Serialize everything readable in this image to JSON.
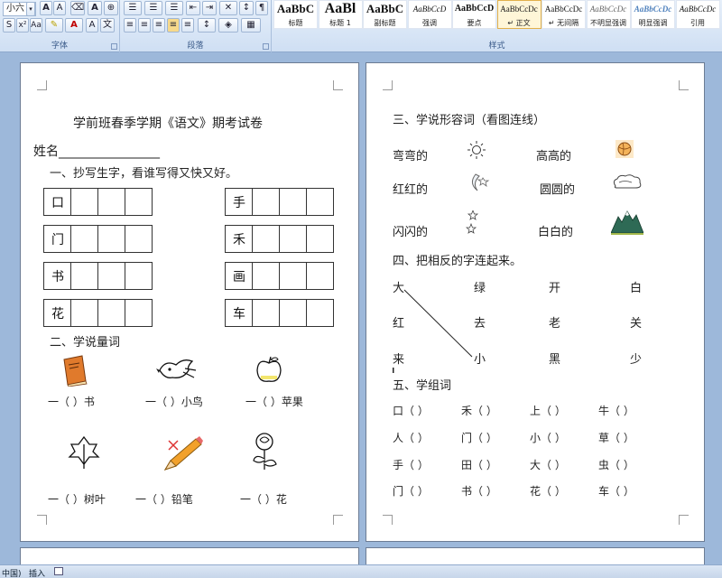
{
  "ribbon": {
    "font_name": "小六",
    "font_group_label": "字体",
    "paragraph_group_label": "段落",
    "styles_group_label": "样式",
    "styles": [
      {
        "sample": "AaBbC",
        "name": "标题"
      },
      {
        "sample": "AaBl",
        "name": "标题 1"
      },
      {
        "sample": "AaBbC",
        "name": "副标题"
      },
      {
        "sample": "AaBbCcD",
        "name": "强调"
      },
      {
        "sample": "AaBbCcD",
        "name": "要点"
      },
      {
        "sample": "AaBbCcDc",
        "name": "↵ 正文"
      },
      {
        "sample": "AaBbCcDc",
        "name": "↵ 无间隔"
      },
      {
        "sample": "AaBbCcDc",
        "name": "不明显强调"
      },
      {
        "sample": "AaBbCcDc",
        "name": "明显强调"
      },
      {
        "sample": "AaBbCcDc",
        "name": "引用"
      }
    ]
  },
  "page1": {
    "title": "学前班春季学期《语文》期考试卷",
    "name_label": "姓名________________",
    "section1": "一、抄写生字，看谁写得又快又好。",
    "left_chars": [
      "口",
      "门",
      "书",
      "花"
    ],
    "right_chars": [
      "手",
      "禾",
      "画",
      "车"
    ],
    "section2": "二、学说量词",
    "measure_row1": [
      "一（  ）书",
      "一（  ）小鸟",
      "一（  ）苹果"
    ],
    "measure_row2": [
      "一（  ）树叶",
      "一（  ）铅笔",
      "一（  ）花"
    ]
  },
  "page2": {
    "section3": "三、学说形容词（看图连线）",
    "adj_left": [
      "弯弯的",
      "红红的",
      "闪闪的"
    ],
    "adj_right": [
      "高高的",
      "圆圆的",
      "白白的"
    ],
    "section4": "四、把相反的字连起来。",
    "opp_rows": [
      [
        "大",
        "绿",
        "开",
        "白"
      ],
      [
        "红",
        "去",
        "老",
        "关"
      ],
      [
        "来",
        "小",
        "黑",
        "少"
      ]
    ],
    "section5": "五、学组词",
    "word_rows": [
      [
        "口（      ）",
        "禾（      ）",
        "上（      ）",
        "牛（      ）"
      ],
      [
        "人（      ）",
        "门（      ）",
        "小（      ）",
        "草（      ）"
      ],
      [
        "手（      ）",
        "田（      ）",
        "大（      ）",
        "虫（      ）"
      ],
      [
        "门（      ）",
        "书（      ）",
        "花（      ）",
        "车（      ）"
      ]
    ]
  },
  "status": {
    "language": "中国)",
    "mode": "插入"
  },
  "colors": {
    "ribbon_top": "#e7f0fb",
    "workspace": "#9db8da",
    "active_style": "#fff6d8"
  }
}
